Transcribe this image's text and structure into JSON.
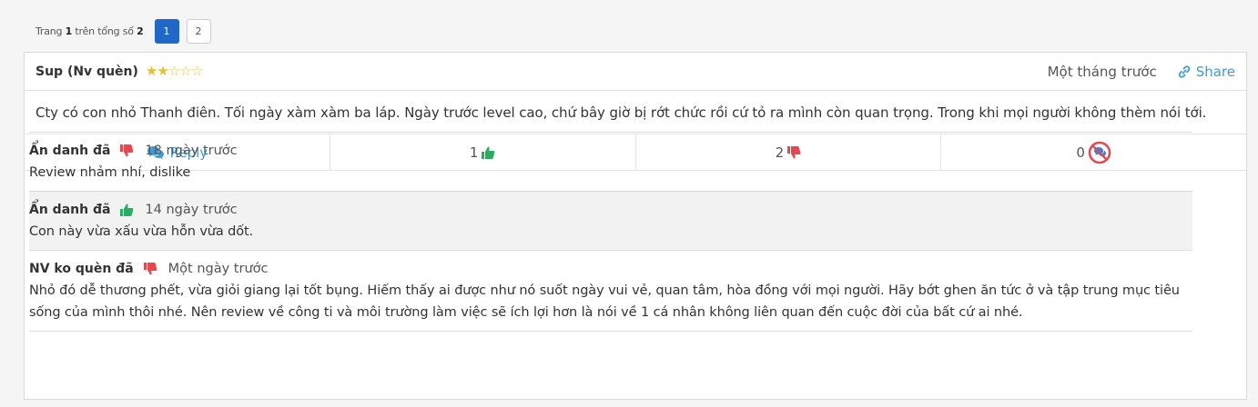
{
  "pagination": {
    "prefix": "Trang",
    "current": "1",
    "middle": "trên tổng số",
    "total": "2",
    "pages": [
      "1",
      "2"
    ]
  },
  "review": {
    "author": "Sup (Nv quèn)",
    "rating": 2,
    "max_rating": 5,
    "time_ago": "Một tháng trước",
    "share_label": "Share",
    "body": "Cty có con nhỏ Thanh điên. Tối ngày xàm xàm ba láp. Ngày trước level cao, chứ bây giờ bị rớt chức rồi cứ tỏ ra mình còn quan trọng. Trong khi mọi người không thèm nói tới.",
    "actions": {
      "reply_label": "Reply",
      "likes": "1",
      "dislikes": "2",
      "reports": "0"
    }
  },
  "comments": [
    {
      "author": "Ẩn danh đã",
      "vote": "dislike",
      "time_ago": "18 ngày trước",
      "text": "Review nhảm nhí, dislike"
    },
    {
      "author": "Ẩn danh đã",
      "vote": "like",
      "time_ago": "14 ngày trước",
      "text": "Con này vừa xấu vừa hỗn vừa dốt."
    },
    {
      "author": "NV ko quèn đã",
      "vote": "dislike",
      "time_ago": "Một ngày trước",
      "text": "Nhỏ đó dễ thương phết, vừa giỏi giang lại tốt bụng. Hiếm thấy ai được như nó suốt ngày vui vẻ, quan tâm, hòa đồng với mọi người. Hãy bớt ghen ăn tức ở và tập trung mục tiêu sống của mình thôi nhé. Nên review về công ti và môi trường làm việc sẽ ích lợi hơn là nói về 1 cá nhân không liên quan đến cuộc đời của bất cứ ai nhé."
    }
  ],
  "colors": {
    "accent": "#3b9be0",
    "active_page": "#1f67c9",
    "like": "#27ae60",
    "dislike": "#e8474f",
    "star": "#e8c02c"
  }
}
